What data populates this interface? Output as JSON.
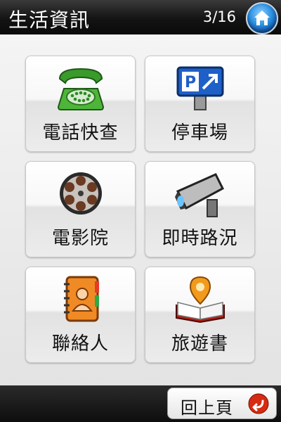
{
  "header": {
    "title": "生活資訊",
    "page_indicator": "3/16",
    "home_icon": "home-icon"
  },
  "grid": {
    "items": [
      {
        "label": "電話快查",
        "icon": "telephone-icon"
      },
      {
        "label": "停車場",
        "icon": "parking-sign-icon"
      },
      {
        "label": "電影院",
        "icon": "film-reel-icon"
      },
      {
        "label": "即時路況",
        "icon": "traffic-camera-icon"
      },
      {
        "label": "聯絡人",
        "icon": "address-book-icon"
      },
      {
        "label": "旅遊書",
        "icon": "travel-book-icon"
      }
    ]
  },
  "footer": {
    "back_label": "回上頁",
    "back_icon": "back-arrow-icon"
  },
  "colors": {
    "header_bg": "#141414",
    "accent_blue": "#2b8fe0",
    "back_icon_red": "#d62a12"
  }
}
